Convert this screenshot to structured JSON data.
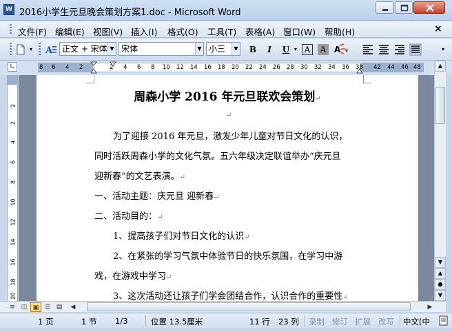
{
  "window": {
    "title": "2016小学生元旦晚会策划方案1.doc - Microsoft Word",
    "app_icon": "W"
  },
  "menu": {
    "items": [
      "文件(F)",
      "编辑(E)",
      "视图(V)",
      "插入(I)",
      "格式(O)",
      "工具(T)",
      "表格(A)",
      "窗口(W)",
      "帮助(H)"
    ],
    "close": "×"
  },
  "toolbar": {
    "style_value": "正文 + 宋体",
    "font_value": "宋体",
    "size_value": "小三",
    "bold": "B",
    "italic": "I",
    "underline": "U",
    "char_border": "A",
    "char_shading": "A"
  },
  "ruler": {
    "h_numbers": [
      "8",
      "6",
      "4",
      "2",
      "2",
      "4",
      "6",
      "8",
      "10",
      "12",
      "14",
      "16",
      "18",
      "20",
      "22",
      "24",
      "26",
      "28",
      "30",
      "32",
      "34",
      "36",
      "38",
      "42",
      "44",
      "46",
      "48"
    ],
    "v_numbers": [
      "2",
      "2",
      "4",
      "6",
      "8",
      "10",
      "12",
      "14",
      "16",
      "18",
      "20"
    ]
  },
  "document": {
    "title": "周森小学 2016 年元旦联欢会策划",
    "lines": [
      "为了迎接 2016 年元旦，激发少年儿童对节日文化的认识，",
      "同时活跃周森小学的文化气氛。五六年级决定联谊举办“庆元旦",
      "迎新春”的文艺表演。",
      "一、活动主题：庆元旦 迎新春",
      "二、活动目的：",
      "1、提高孩子们对节日文化的认识",
      "2、在紧张的学习气氛中体验节日的快乐氛围，在学习中游",
      "戏，在游戏中学习",
      "3、这次活动还让孩子们学会团结合作，认识合作的重要性"
    ],
    "para_mark": "↵"
  },
  "status": {
    "page": "1 页",
    "section": "1 节",
    "page_of": "1/3",
    "position": "位置 13.5厘米",
    "line": "11 行",
    "column": "23 列",
    "rec": "录制",
    "trk": "修订",
    "ext": "扩展",
    "ovr": "改写",
    "lang": "中文(中"
  },
  "colors": {
    "chrome": "#d4e0ef",
    "doc_background": "#7a8a9c",
    "page": "#ffffff",
    "close_button": "#c6412a"
  }
}
